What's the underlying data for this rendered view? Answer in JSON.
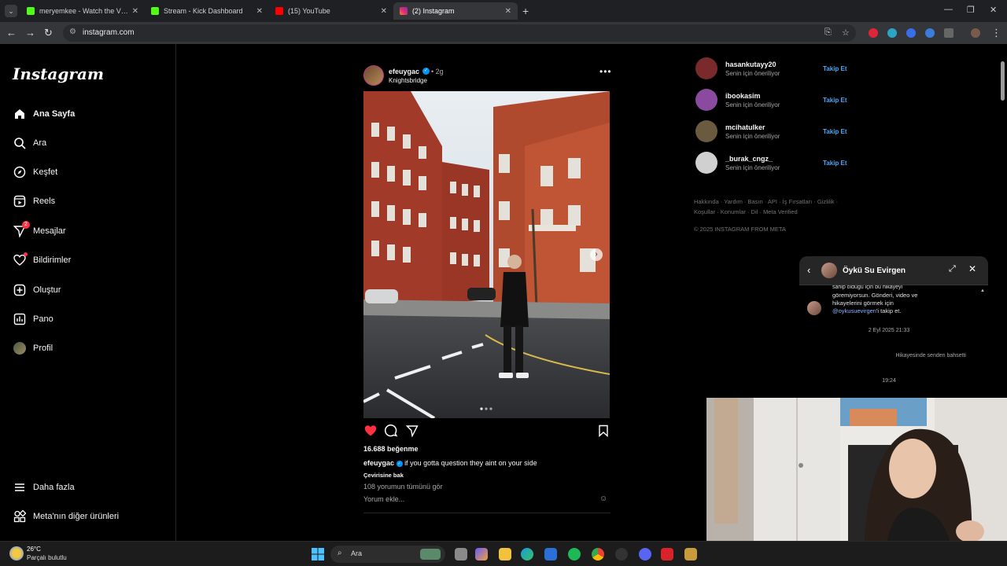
{
  "browser": {
    "tabs": [
      {
        "label": "meryemkee - Watch the VOD o",
        "fav_color": "#53fc18"
      },
      {
        "label": "Stream - Kick Dashboard",
        "fav_color": "#53fc18"
      },
      {
        "label": "(15) YouTube",
        "fav_color": "#ff0000"
      },
      {
        "label": "(2) Instagram",
        "fav_color": "#e1306c"
      }
    ],
    "url": "instagram.com"
  },
  "instagram": {
    "logo": "Instagram",
    "nav": [
      {
        "label": "Ana Sayfa",
        "icon": "home-icon"
      },
      {
        "label": "Ara",
        "icon": "search-icon"
      },
      {
        "label": "Keşfet",
        "icon": "compass-icon"
      },
      {
        "label": "Reels",
        "icon": "reels-icon"
      },
      {
        "label": "Mesajlar",
        "icon": "send-icon",
        "badge": "2"
      },
      {
        "label": "Bildirimler",
        "icon": "heart-icon"
      },
      {
        "label": "Oluştur",
        "icon": "plus-square-icon"
      },
      {
        "label": "Pano",
        "icon": "chart-icon"
      },
      {
        "label": "Profil",
        "icon": "profile-avatar"
      }
    ],
    "more": {
      "label": "Daha fazla",
      "icon": "menu-icon"
    },
    "meta": {
      "label": "Meta'nın diğer ürünleri",
      "icon": "grid-icon"
    },
    "post": {
      "username": "efeuygac",
      "time": "• 2g",
      "location": "Knightsbridge",
      "likes": "16.688 beğenme",
      "caption_user": "efeuygac",
      "caption": "if you gotta question they aint on your side",
      "translate": "Çevirisine bak",
      "comments": "108 yorumun tümünü gör",
      "comment_placeholder": "Yorum ekle..."
    },
    "suggestions": [
      {
        "name": "hasankutayy20",
        "sub": "Senin için öneriliyor",
        "follow": "Takip Et",
        "color": "#7a2a2a"
      },
      {
        "name": "ibookasim",
        "sub": "Senin için öneriliyor",
        "follow": "Takip Et",
        "color": "#8a4aa0"
      },
      {
        "name": "mcihatulker",
        "sub": "Senin için öneriliyor",
        "follow": "Takip Et",
        "color": "#6a5a40"
      },
      {
        "name": "_burak_cngz_",
        "sub": "Senin için öneriliyor",
        "follow": "Takip Et",
        "color": "#d0d0d0"
      }
    ],
    "footer_links": "Hakkında · Yardım · Basın · API · İş Fırsatları · Gizlilik · Koşullar · Konumlar · Dil · Meta Verified",
    "copyright": "© 2025 INSTAGRAM FROM META"
  },
  "chat": {
    "title": "Öykü Su Evirgen",
    "msg_partial": "sahip olduğu için bu hikayeyi",
    "msg_line1": "göremiyorsun. Gönderi, video ve",
    "msg_line2": "hikayelerini görmek için",
    "msg_link": "@oykusuevirgen",
    "msg_suffix": "'i takip et.",
    "timestamp1": "2 Eyl 2025 21:33",
    "story_mention": "Hikayesinde senden bahsetti",
    "timestamp2": "19:24"
  },
  "taskbar": {
    "weather_temp": "26°C",
    "weather_desc": "Parçalı bulutlu",
    "search_label": "Ara"
  }
}
